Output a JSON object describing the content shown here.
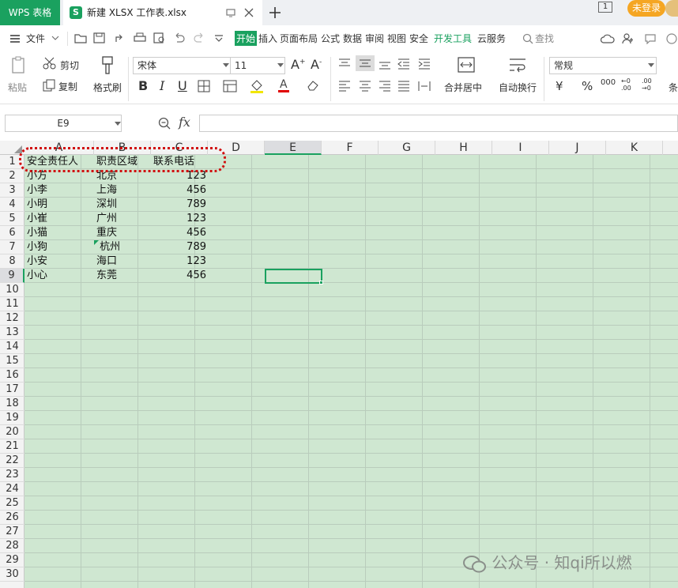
{
  "tabbar": {
    "app_tab": "WPS 表格",
    "doc_tab": "新建 XLSX 工作表.xlsx",
    "doc_icon": "S",
    "login": "未登录",
    "page_indicator": "1"
  },
  "menubar": {
    "file": "文件",
    "tabs": [
      "开始",
      "插入",
      "页面布局",
      "公式",
      "数据",
      "审阅",
      "视图",
      "安全",
      "开发工具",
      "云服务"
    ],
    "active_tab": "开始",
    "search": "查找"
  },
  "toolbar": {
    "paste": "粘贴",
    "cut": "剪切",
    "copy": "复制",
    "format_painter": "格式刷",
    "font_name": "宋体",
    "font_size": "11",
    "bold": "B",
    "italic": "I",
    "underline": "U",
    "merge_center": "合并居中",
    "wrap_text": "自动换行",
    "number_format": "常规",
    "currency": "¥",
    "percent": "%",
    "thousands": "000",
    "more": "条"
  },
  "formula_bar": {
    "name_box": "E9",
    "fx": "fx",
    "formula": ""
  },
  "sheet": {
    "columns": [
      "A",
      "B",
      "C",
      "D",
      "E",
      "F",
      "G",
      "H",
      "I",
      "J",
      "K"
    ],
    "active_column": "E",
    "active_row": "9",
    "rows": [
      "1",
      "2",
      "3",
      "4",
      "5",
      "6",
      "7",
      "8",
      "9",
      "10",
      "11",
      "12",
      "13",
      "14",
      "15",
      "16",
      "17",
      "18",
      "19",
      "20",
      "21",
      "22",
      "23",
      "24",
      "25",
      "26",
      "27",
      "28",
      "29",
      "30"
    ],
    "data": [
      {
        "a": "安全责任人",
        "b": "职责区域",
        "c": "联系电话"
      },
      {
        "a": "小方",
        "b": "北京",
        "c": "123"
      },
      {
        "a": "小李",
        "b": "上海",
        "c": "456"
      },
      {
        "a": "小明",
        "b": "深圳",
        "c": "789"
      },
      {
        "a": "小崔",
        "b": "广州",
        "c": "123"
      },
      {
        "a": "小猫",
        "b": "重庆",
        "c": "456"
      },
      {
        "a": "小狗",
        "b": " 杭州",
        "c": "789"
      },
      {
        "a": "小安",
        "b": "海口",
        "c": "123"
      },
      {
        "a": "小心",
        "b": "东莞",
        "c": "456"
      }
    ]
  },
  "watermark": "公众号 · 知qi所以燃",
  "colors": {
    "accent": "#1aa15f",
    "grid_bg": "#cfe7d1",
    "highlight_dash": "#d01010",
    "login_bg": "#f5a623"
  }
}
